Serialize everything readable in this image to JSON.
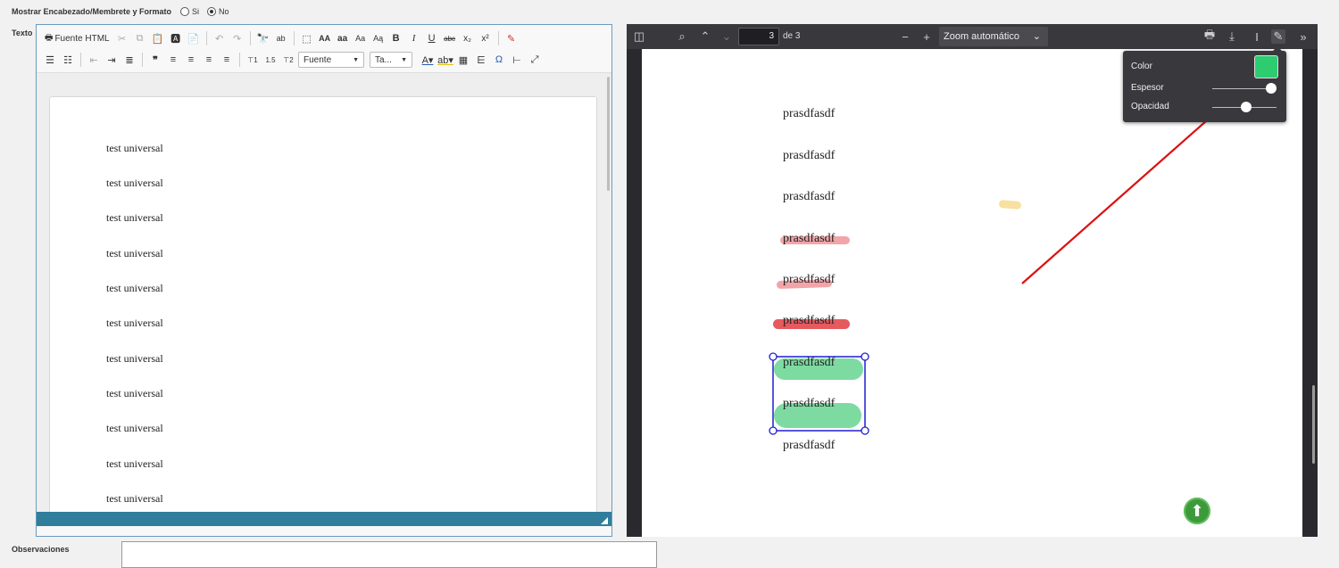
{
  "header": {
    "show_header_label": "Mostrar Encabezado/Membrete y Formato",
    "radio_si": "Si",
    "radio_no": "No",
    "selected": "No"
  },
  "texto_label": "Texto",
  "observaciones_label": "Observaciones",
  "editor": {
    "source_button": "Fuente HTML",
    "font_combo": "Fuente",
    "size_combo": "Ta...",
    "lines": [
      "test universal",
      "test universal",
      "test universal",
      "test universal",
      "test universal",
      "test universal",
      "test universal",
      "test universal",
      "test universal",
      "test universal",
      "test universal"
    ]
  },
  "viewer": {
    "page_number": "3",
    "page_total": "de 3",
    "zoom": "Zoom automático",
    "lines": [
      "prasdfasdf",
      "prasdfasdf",
      "prasdfasdf",
      "prasdfasdf",
      "prasdfasdf",
      "prasdfasdf",
      "prasdfasdf",
      "prasdfasdf",
      "prasdfasdf"
    ],
    "popup": {
      "color_label": "Color",
      "thickness_label": "Espesor",
      "opacity_label": "Opacidad",
      "color_value": "#2ecc71"
    }
  },
  "colors": {
    "annotation_arrow": "#dd1111",
    "highlight_pink": "#f2a5a9",
    "highlight_red": "#e55a5f",
    "highlight_green": "#7ddba2",
    "highlight_yellow": "#f8e0a0",
    "selection_box": "#1f1fd0"
  }
}
